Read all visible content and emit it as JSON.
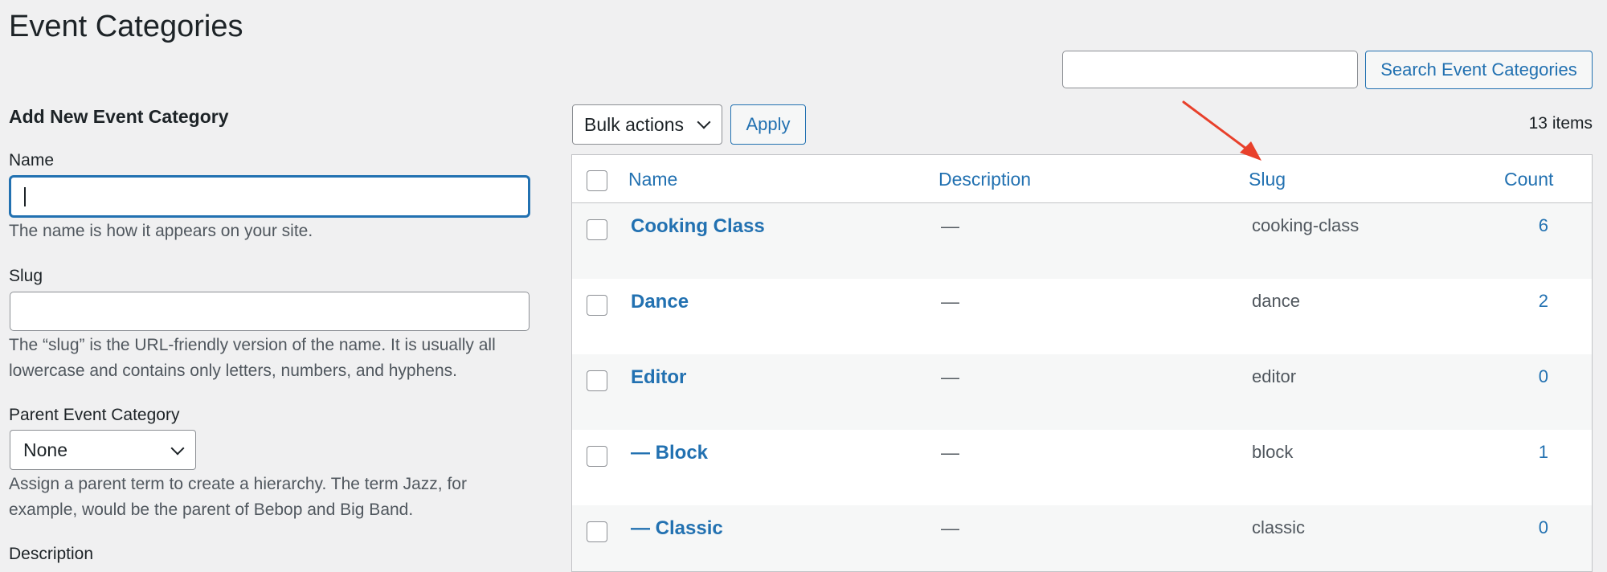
{
  "page": {
    "title": "Event Categories"
  },
  "search": {
    "value": "",
    "button_label": "Search Event Categories"
  },
  "form": {
    "heading": "Add New Event Category",
    "name_label": "Name",
    "name_value": "",
    "name_help": "The name is how it appears on your site.",
    "slug_label": "Slug",
    "slug_value": "",
    "slug_help": "The “slug” is the URL-friendly version of the name. It is usually all lowercase and contains only letters, numbers, and hyphens.",
    "parent_label": "Parent Event Category",
    "parent_selected": "None",
    "parent_help": "Assign a parent term to create a hierarchy. The term Jazz, for example, would be the parent of Bebop and Big Band.",
    "description_label": "Description"
  },
  "toolbar": {
    "bulk_selected": "Bulk actions",
    "apply_label": "Apply",
    "items_count": "13 items"
  },
  "table": {
    "columns": {
      "name": "Name",
      "description": "Description",
      "slug": "Slug",
      "count": "Count"
    },
    "rows": [
      {
        "name": "Cooking Class",
        "description": "—",
        "slug": "cooking-class",
        "count": "6"
      },
      {
        "name": "Dance",
        "description": "—",
        "slug": "dance",
        "count": "2"
      },
      {
        "name": "Editor",
        "description": "—",
        "slug": "editor",
        "count": "0"
      },
      {
        "name": "— Block",
        "description": "—",
        "slug": "block",
        "count": "1"
      },
      {
        "name": "— Classic",
        "description": "—",
        "slug": "classic",
        "count": "0"
      }
    ]
  },
  "colors": {
    "background": "#f0f0f1",
    "link": "#2271b1",
    "text": "#1d2327",
    "muted_text": "#50575e",
    "border": "#c3c4c7",
    "annotation_arrow": "#e8402b"
  }
}
